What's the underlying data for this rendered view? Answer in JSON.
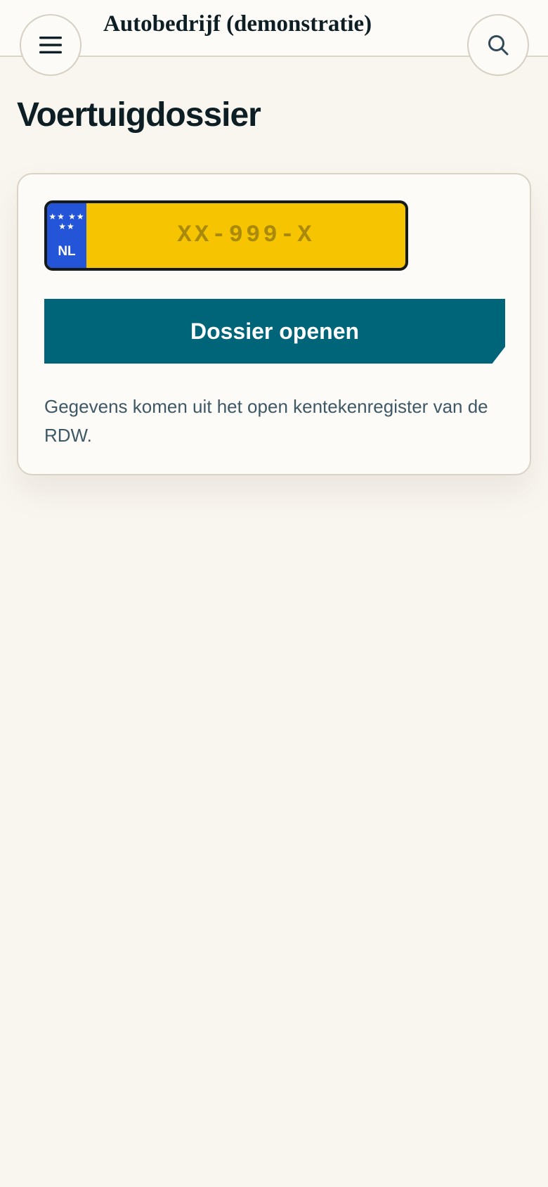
{
  "header": {
    "site_title": "Autobedrijf (demonstratie)",
    "menu_icon": "hamburger-menu-icon",
    "search_icon": "search-icon"
  },
  "page": {
    "title": "Voertuigdossier"
  },
  "plate": {
    "country": "NL",
    "stars": "★★ ★★ ★★",
    "placeholder": "XX-999-X",
    "value": ""
  },
  "form": {
    "submit_label": "Dossier openen",
    "info": "Gegevens komen uit het open kentekenregister van de RDW."
  },
  "colors": {
    "background": "#f9f6f0",
    "accent": "#006579",
    "plate_yellow": "#f6c400",
    "plate_blue": "#2454d8",
    "text": "#0d1f24"
  }
}
